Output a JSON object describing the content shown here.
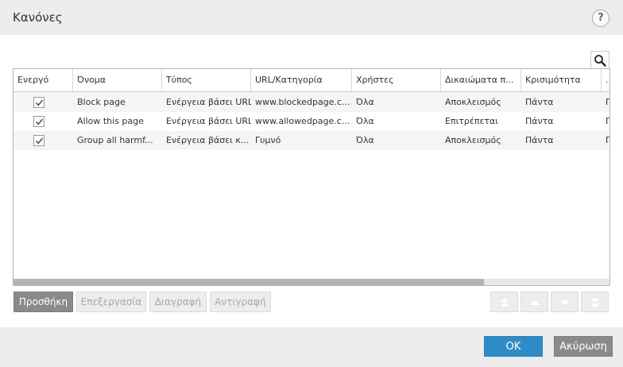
{
  "dialog": {
    "title": "Κανόνες",
    "help_label": "?"
  },
  "table": {
    "columns": [
      "Ενεργό",
      "Όνομα",
      "Τύπος",
      "URL/Κατηγορία",
      "Χρήστες",
      "Δικαιώματα π...",
      "Κρισιμότητα",
      "..."
    ],
    "rows": [
      {
        "enabled": true,
        "name": "Block page",
        "type": "Ενέργεια βάσει URL",
        "url": "www.blockedpage.c...",
        "users": "Όλα",
        "rights": "Αποκλεισμός",
        "severity": "Πάντα",
        "extra": "Γ"
      },
      {
        "enabled": true,
        "name": "Allow this page",
        "type": "Ενέργεια βάσει URL",
        "url": "www.allowedpage.c...",
        "users": "Όλα",
        "rights": "Επιτρέπεται",
        "severity": "Πάντα",
        "extra": "Γ"
      },
      {
        "enabled": true,
        "name": "Group all harmf...",
        "type": "Ενέργεια βάσει κ...",
        "url": "Γυμνό",
        "users": "Όλα",
        "rights": "Αποκλεισμός",
        "severity": "Πάντα",
        "extra": "Γ"
      }
    ]
  },
  "toolbar": {
    "add_label": "Προσθήκη",
    "edit_label": "Επεξεργασία",
    "delete_label": "Διαγραφή",
    "copy_label": "Αντιγραφή"
  },
  "footer": {
    "ok_label": "OK",
    "cancel_label": "Ακύρωση"
  },
  "colors": {
    "accent": "#2d8cc8",
    "button_dark": "#8a8a8a"
  },
  "icons": {
    "help": "help-icon",
    "search": "search-icon",
    "move_top": "move-top-icon",
    "move_up": "move-up-icon",
    "move_down": "move-down-icon",
    "move_bottom": "move-bottom-icon",
    "check": "checkmark-icon"
  }
}
